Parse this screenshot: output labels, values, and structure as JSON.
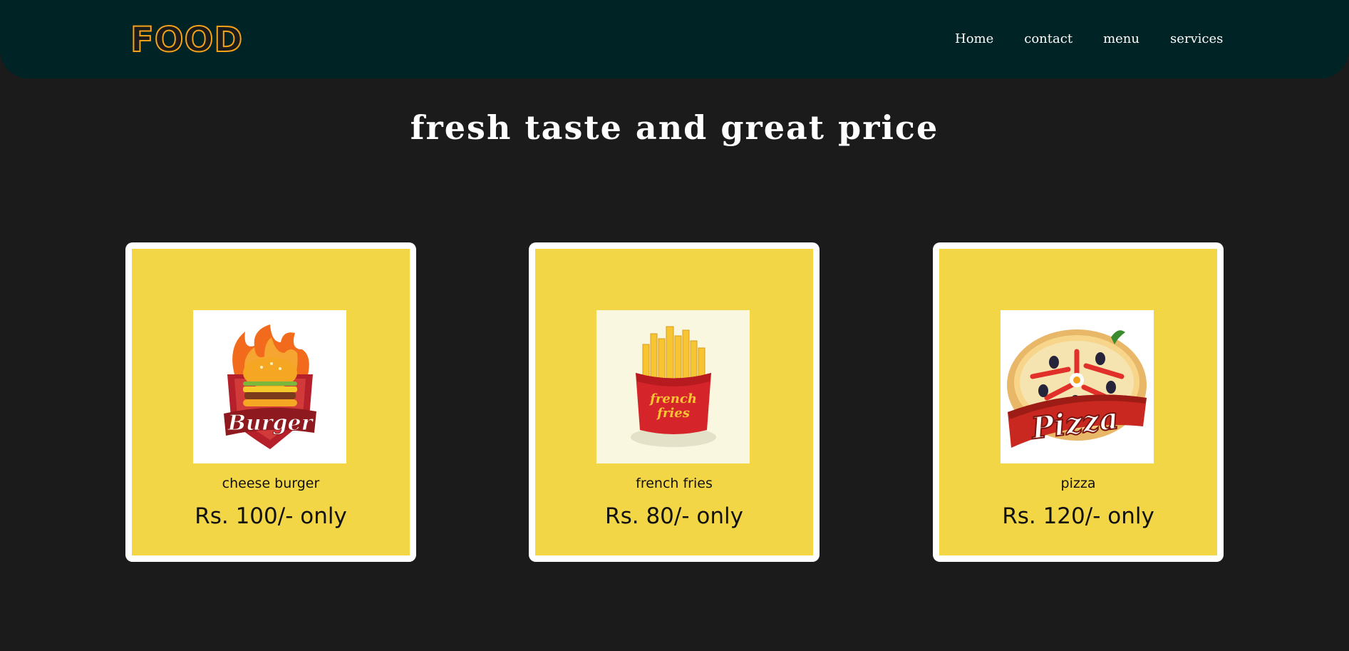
{
  "brand": {
    "logo": "FOOD",
    "accent": "#f5a21a",
    "nav_bg": "#002326",
    "page_bg": "#1b1b1b",
    "card_bg": "#f3d646"
  },
  "nav": {
    "items": [
      "Home",
      "contact",
      "menu",
      "services"
    ]
  },
  "hero": {
    "headline": "fresh taste and great price"
  },
  "cards": [
    {
      "name": "cheese burger",
      "price": "Rs. 100/- only",
      "image_label": "Burger",
      "icon": "burger-logo-icon"
    },
    {
      "name": "french fries",
      "price": "Rs. 80/- only",
      "image_label": "french fries",
      "icon": "french-fries-logo-icon"
    },
    {
      "name": "pizza",
      "price": "Rs. 120/- only",
      "image_label": "Pizza",
      "icon": "pizza-logo-icon"
    }
  ]
}
